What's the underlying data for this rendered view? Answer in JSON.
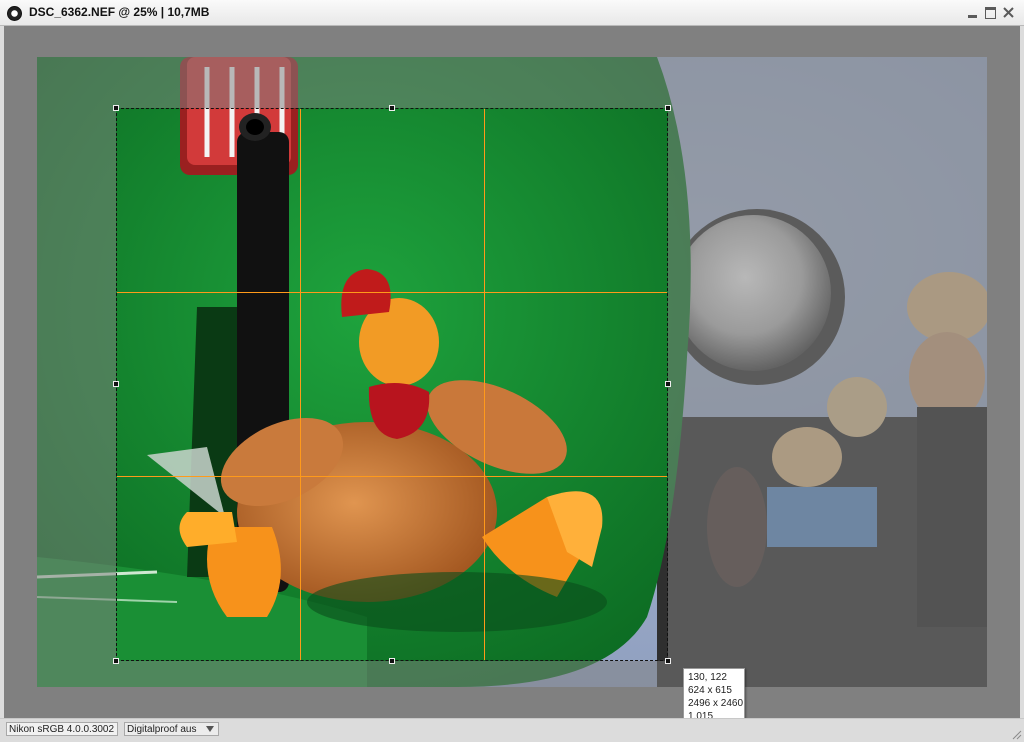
{
  "window": {
    "title": "DSC_6362.NEF @ 25% | 10,7MB",
    "app_icon": "camera-aperture-icon",
    "controls": [
      "minimize-icon",
      "maximize-icon",
      "close-icon"
    ]
  },
  "crop_info": {
    "line1": "130, 122",
    "line2": "624 x 615",
    "line3": "2496 x 2460",
    "line4": "1.015"
  },
  "status": {
    "profile": "Nikon sRGB 4.0.0.3002",
    "proof_label": "Digitalproof aus"
  },
  "colors": {
    "crop_guides": "#ff9a1a",
    "background": "#808080"
  }
}
